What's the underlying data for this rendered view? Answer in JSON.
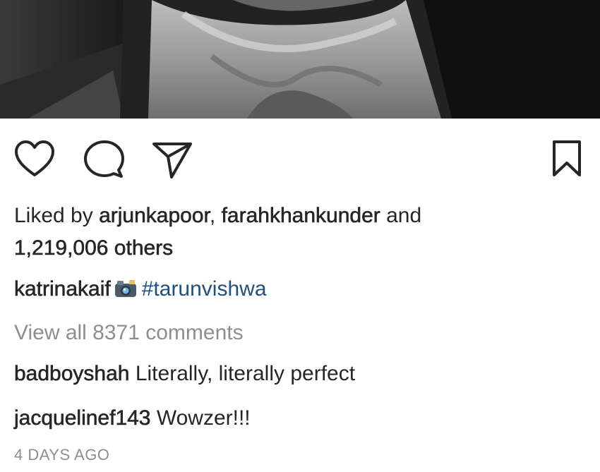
{
  "post": {
    "photo_description_icon": "photo-image",
    "actions": {
      "like_icon": "heart-icon",
      "comment_icon": "comment-icon",
      "share_icon": "paper-plane-icon",
      "save_icon": "bookmark-icon"
    },
    "likes": {
      "prefix": "Liked by",
      "user1": "arjunkapoor",
      "separator": ",",
      "user2": "farahkhankunder",
      "and": "and",
      "others": "1,219,006 others"
    },
    "caption": {
      "username": "katrinakaif",
      "emoji_icon": "camera-with-flash-icon",
      "hashtag": "#tarunvishwa"
    },
    "view_all_comments": "View all 8371 comments",
    "comments": [
      {
        "username": "badboyshah",
        "text": "Literally, literally perfect"
      },
      {
        "username": "jacquelinef143",
        "text": "Wowzer!!!"
      }
    ],
    "timestamp": "4 DAYS AGO"
  },
  "colors": {
    "text": "#262626",
    "muted": "#8e8e8e",
    "hashtag": "#1e4f80",
    "background": "#ffffff"
  }
}
